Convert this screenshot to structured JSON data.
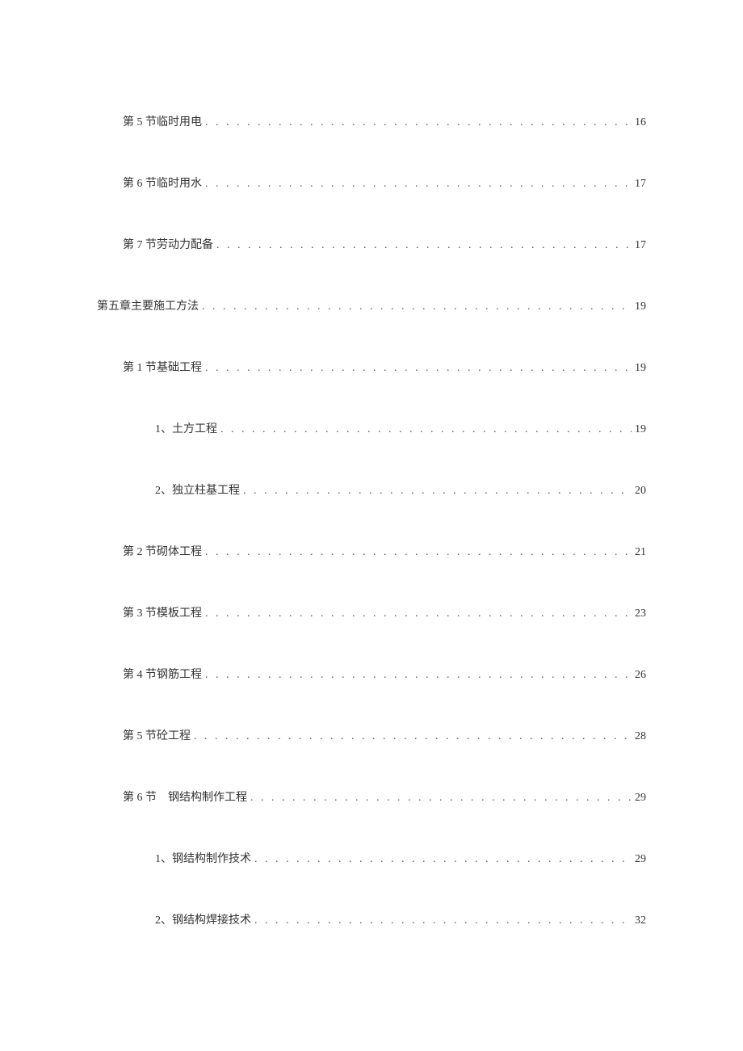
{
  "toc": [
    {
      "level": 1,
      "title": "第 5 节临时用电",
      "page": "16"
    },
    {
      "level": 1,
      "title": "第 6 节临时用水",
      "page": "17"
    },
    {
      "level": 1,
      "title": "第 7 节劳动力配备",
      "page": "17"
    },
    {
      "level": 0,
      "title": "第五章主要施工方法",
      "page": "19"
    },
    {
      "level": 1,
      "title": "第 1 节基础工程",
      "page": "19"
    },
    {
      "level": 2,
      "title": "1、土方工程",
      "page": "19"
    },
    {
      "level": 2,
      "title": "2、独立柱基工程",
      "page": "20"
    },
    {
      "level": 1,
      "title": "第 2 节砌体工程",
      "page": "21"
    },
    {
      "level": 1,
      "title": "第 3 节模板工程",
      "page": "23"
    },
    {
      "level": 1,
      "title": "第 4 节钢筋工程",
      "page": "26"
    },
    {
      "level": 1,
      "title": "第 5 节砼工程",
      "page": "28"
    },
    {
      "level": 1,
      "title": "第 6 节　钢结构制作工程",
      "page": "29"
    },
    {
      "level": 2,
      "title": "1、钢结构制作技术",
      "page": "29"
    },
    {
      "level": 2,
      "title": "2、钢结构焊接技术",
      "page": "32"
    }
  ]
}
